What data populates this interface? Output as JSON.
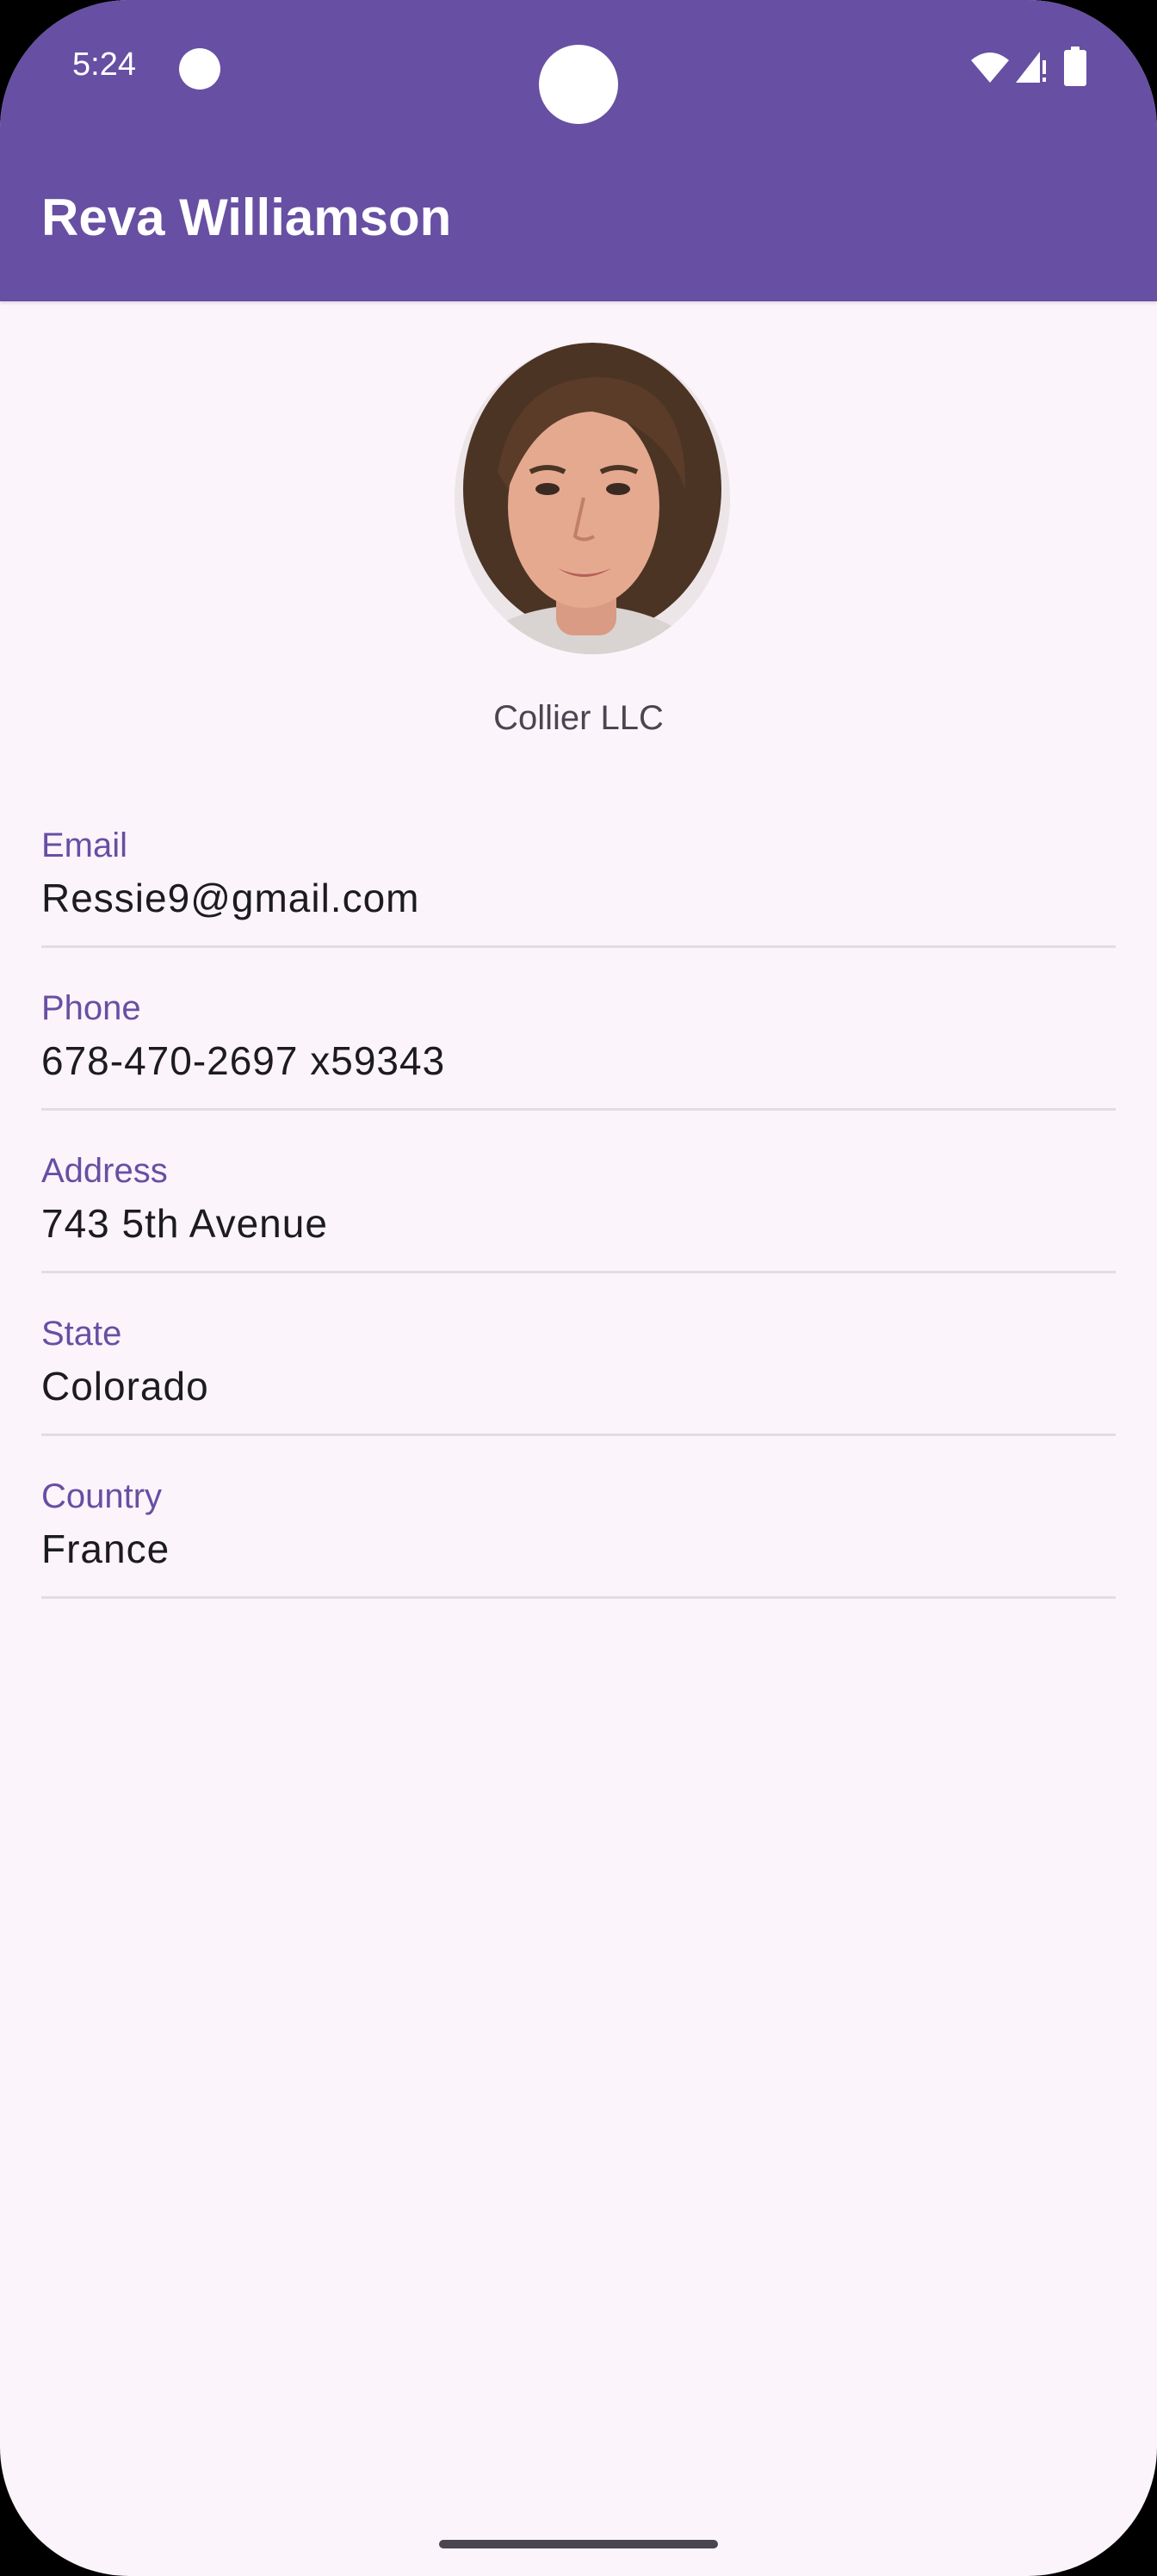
{
  "status_bar": {
    "time": "5:24",
    "icons": [
      "notification-dot-icon",
      "camera-cutout",
      "wifi-icon",
      "signal-icon",
      "battery-icon"
    ]
  },
  "app_bar": {
    "title": "Reva Williamson",
    "color": "#674fa3"
  },
  "profile": {
    "company": "Collier LLC"
  },
  "fields": [
    {
      "label": "Email",
      "value": "Ressie9@gmail.com"
    },
    {
      "label": "Phone",
      "value": "678-470-2697 x59343"
    },
    {
      "label": "Address",
      "value": "743 5th Avenue"
    },
    {
      "label": "State",
      "value": "Colorado"
    },
    {
      "label": "Country",
      "value": "France"
    }
  ],
  "colors": {
    "accent": "#674fa3",
    "background": "#fcf4fb",
    "text": "#1c1b1f"
  }
}
